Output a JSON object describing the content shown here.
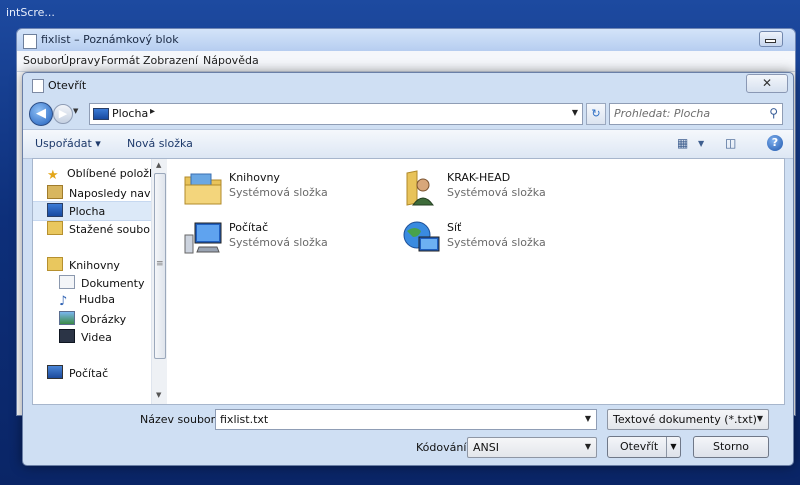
{
  "desktop": {
    "text": "intScre..."
  },
  "notepad": {
    "title": "fixlist – Poznámkový blok",
    "menu": [
      "Soubor",
      "Úpravy",
      "Formát",
      "Zobrazení",
      "Nápověda"
    ]
  },
  "dialog": {
    "title": "Otevřít",
    "close": "✕",
    "address": {
      "location": "Plocha"
    },
    "search": {
      "placeholder": "Prohledat: Plocha"
    },
    "toolbar": {
      "organize": "Uspořádat",
      "new_folder": "Nová složka"
    },
    "nav": {
      "favorites": "Oblíbené položky",
      "recent": "Naposledy navští",
      "desktop": "Plocha",
      "downloads": "Stažené soubory",
      "libraries": "Knihovny",
      "documents": "Dokumenty",
      "music": "Hudba",
      "pictures": "Obrázky",
      "videos": "Videa",
      "computer": "Počítač"
    },
    "items": [
      {
        "name": "Knihovny",
        "desc": "Systémová složka"
      },
      {
        "name": "KRAK-HEAD",
        "desc": "Systémová složka"
      },
      {
        "name": "Počítač",
        "desc": "Systémová složka"
      },
      {
        "name": "Síť",
        "desc": "Systémová složka"
      }
    ],
    "filename_label": "Název souboru:",
    "filename": "fixlist.txt",
    "filetype": "Textové dokumenty (*.txt)",
    "encoding_label": "Kódování:",
    "encoding": "ANSI",
    "open_button": "Otevřít",
    "cancel_button": "Storno"
  }
}
